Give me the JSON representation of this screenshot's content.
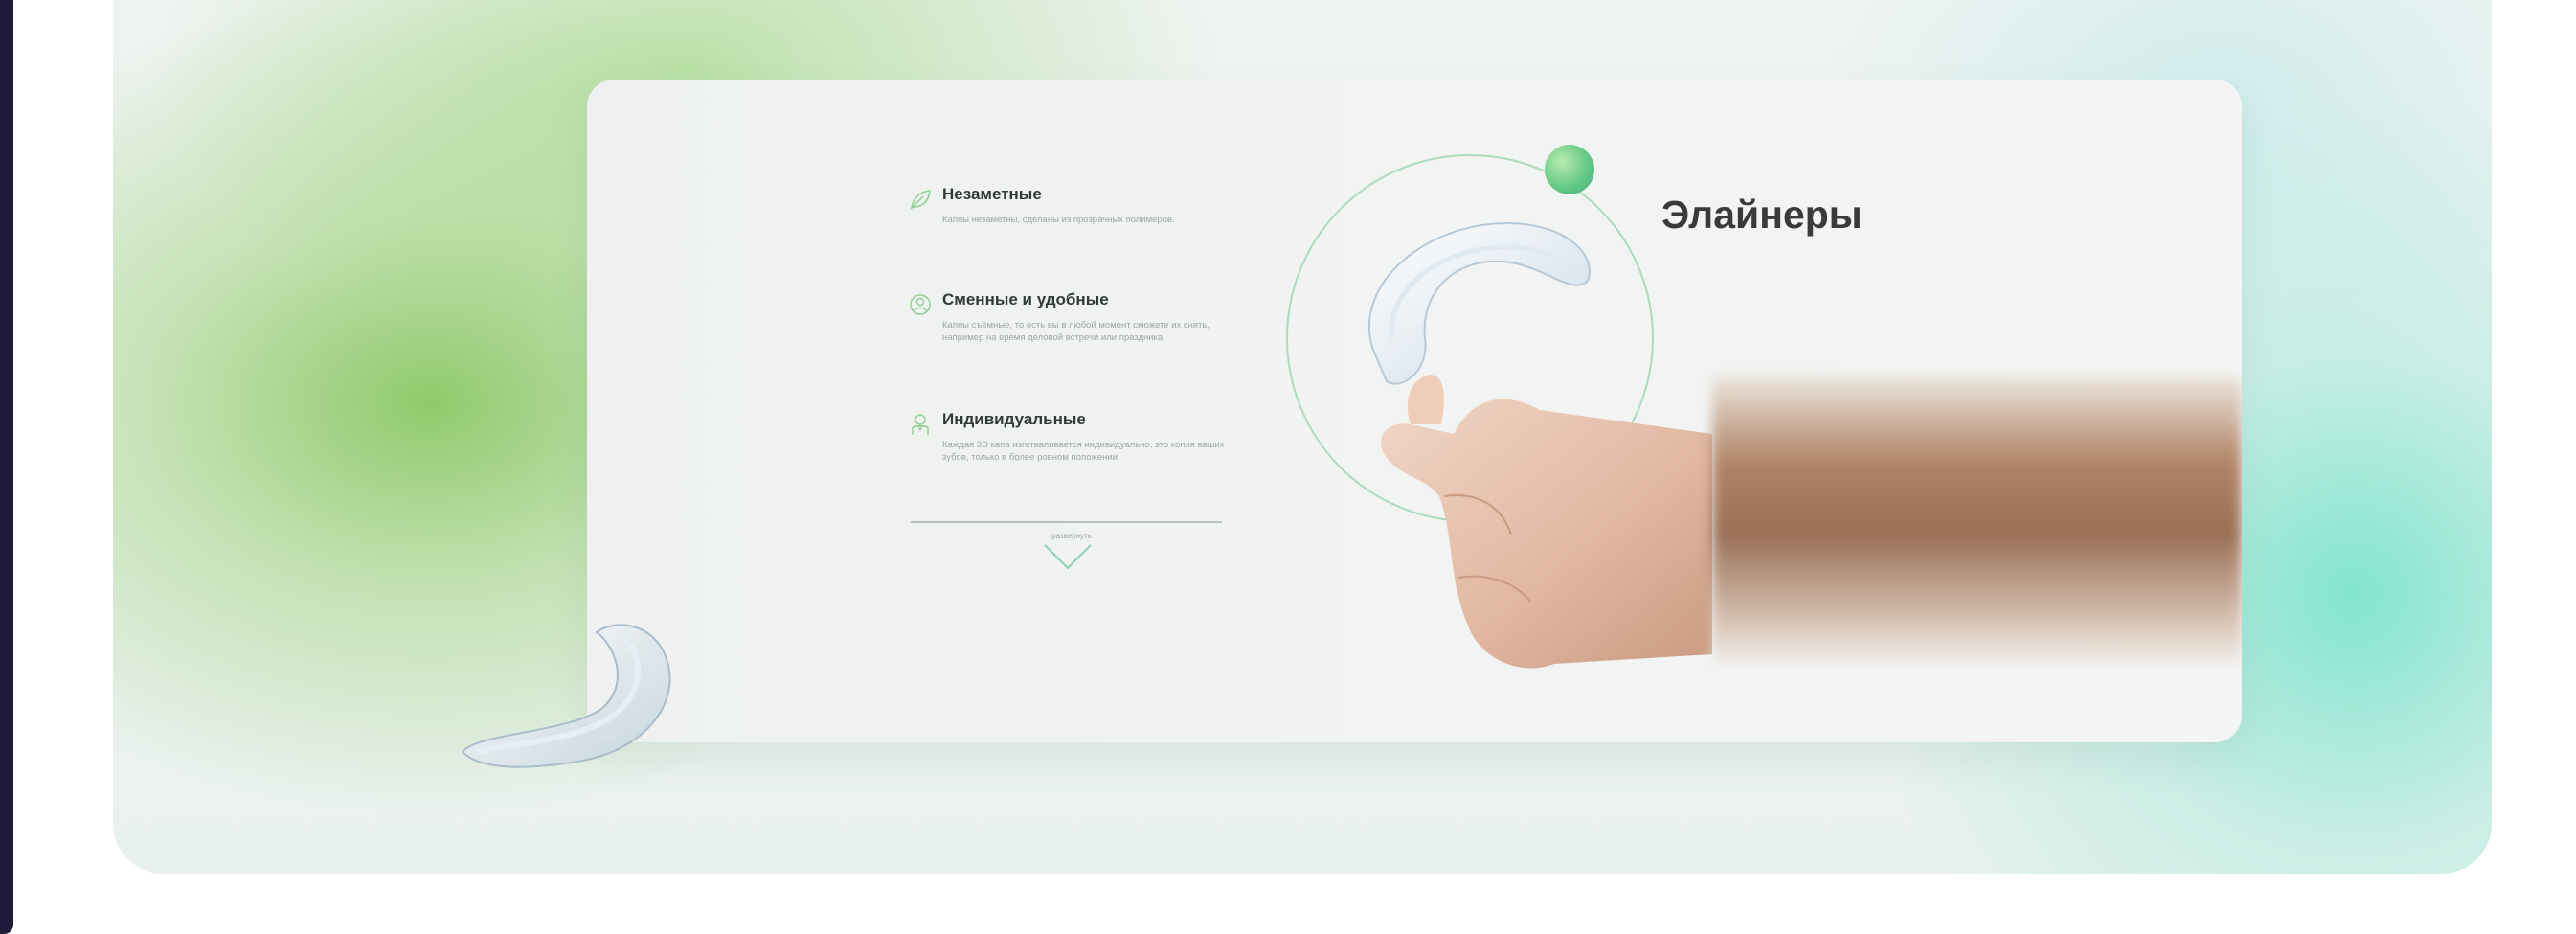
{
  "colors": {
    "accent_green": "#66c885",
    "accent_teal": "#60e0c4",
    "heading_text": "#3a3a3a",
    "sidebar_dark": "#1e1a3a"
  },
  "promo": {
    "title": "Элайнеры",
    "features": [
      {
        "icon": "leaf-icon",
        "title": "Незаметные",
        "description": "Каппы незаметны, сделаны из прозрачных полимеров."
      },
      {
        "icon": "person-icon",
        "title": "Сменные и удобные",
        "description": "Каппы съёмные, то есть вы в любой момент сможете их снять, например на время деловой встречи или праздника."
      },
      {
        "icon": "profile-icon",
        "title": "Индивидуальные",
        "description": "Каждая 3D капа изготавливается индивидуально, это копия ваших зубов, только в более ровном положении."
      }
    ],
    "expand_label": "развернуть"
  }
}
